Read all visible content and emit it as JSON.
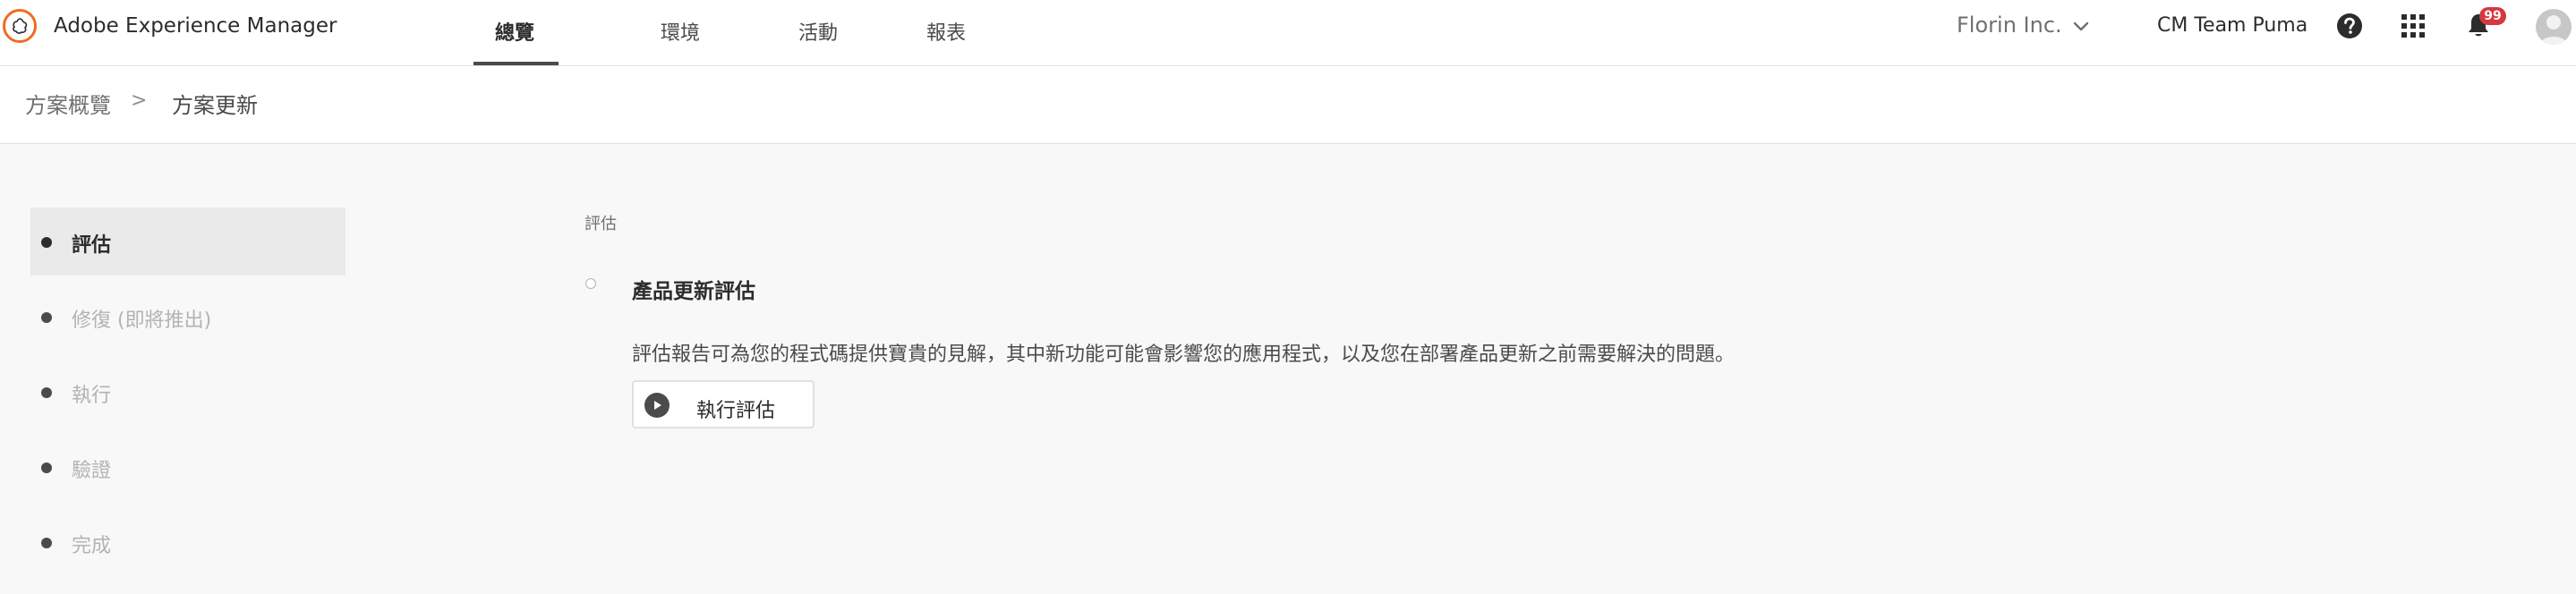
{
  "header": {
    "app_title": "Adobe Experience Manager",
    "tabs": [
      {
        "label": "總覽",
        "active": true
      },
      {
        "label": "環境",
        "active": false
      },
      {
        "label": "活動",
        "active": false
      },
      {
        "label": "報表",
        "active": false
      }
    ],
    "org_name": "Florin Inc.",
    "program_name": "CM Team Puma",
    "notification_count": "99",
    "icons": {
      "logo": "aem-logo-icon",
      "help": "help-icon",
      "apps": "app-grid-icon",
      "notifications": "bell-icon",
      "avatar": "user-avatar-icon",
      "org_dropdown": "chevron-down-icon"
    }
  },
  "breadcrumb": {
    "parent": "方案概覽",
    "separator": ">",
    "current": "方案更新"
  },
  "steps": [
    {
      "label": "評估",
      "active": true
    },
    {
      "label": "修復 (即將推出)",
      "active": false
    },
    {
      "label": "執行",
      "active": false
    },
    {
      "label": "驗證",
      "active": false
    },
    {
      "label": "完成",
      "active": false
    }
  ],
  "main": {
    "section_label": "評估",
    "check_title": "產品更新評估",
    "check_description": "評估報告可為您的程式碼提供寶貴的見解，其中新功能可能會影響您的應用程式，以及您在部署產品更新之前需要解決的問題。",
    "run_button_label": "執行評估",
    "run_button_icon": "play-icon"
  },
  "colors": {
    "accent_logo": "#f26b1d",
    "badge": "#d7373f",
    "text_primary": "#2c2c2c",
    "text_disabled": "#b3b3b3",
    "page_background": "#f8f8f8"
  }
}
